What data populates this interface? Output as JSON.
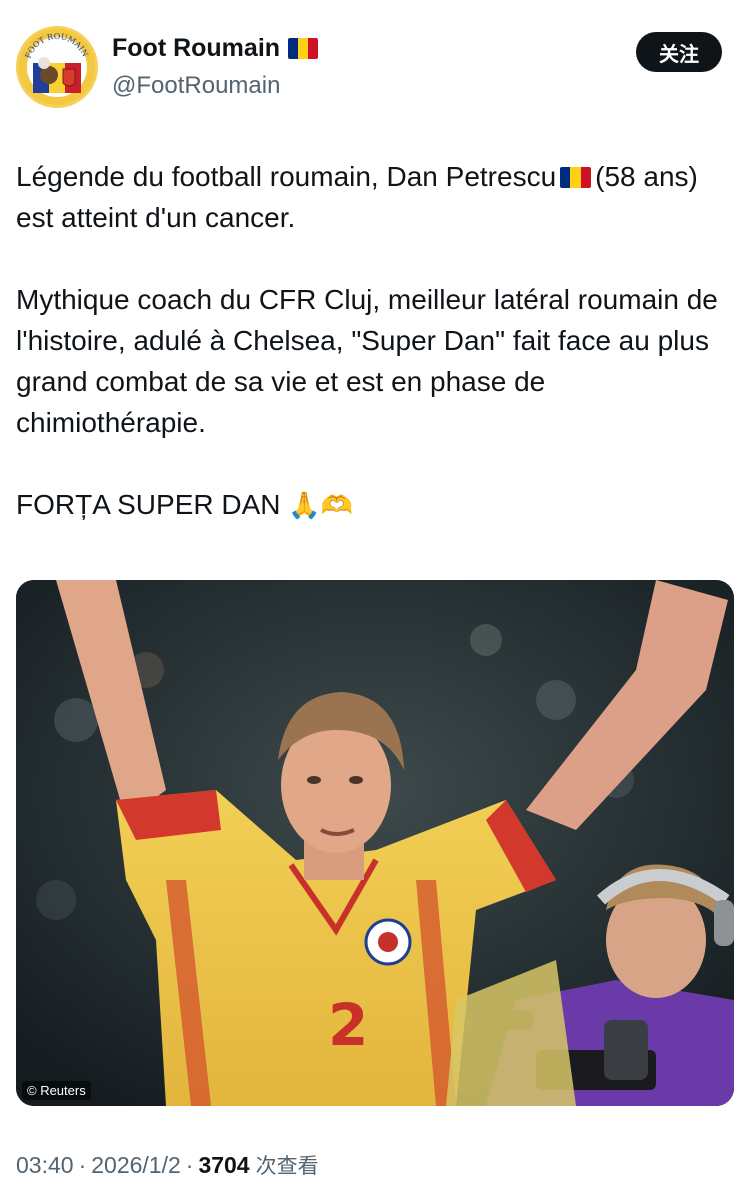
{
  "author": {
    "display_name": "Foot Roumain",
    "handle": "@FootRoumain",
    "avatar_icon": "foot-roumain-logo",
    "avatar_text": "FOOT ROUMAIN",
    "flag_colors": [
      "#002B7F",
      "#FCD116",
      "#CE1126"
    ]
  },
  "follow_button": {
    "label": "关注"
  },
  "tweet": {
    "line1_before_flag": "Légende du football roumain, Dan Petrescu",
    "line1_after_flag": "(58 ans) est atteint d'un cancer.",
    "paragraph2": "Mythique coach du CFR Cluj, meilleur latéral roumain de l'histoire, adulé à Chelsea, \"Super Dan\" fait face au plus grand combat de sa vie et est en phase de chimiothérapie.",
    "paragraph3": "FORȚA SUPER DAN",
    "emojis": "🙏🫶"
  },
  "media": {
    "credit": "© Reuters"
  },
  "meta": {
    "time": "03:40",
    "date": "2026/1/2",
    "views": "3704",
    "views_label": "次查看",
    "separator": "·"
  }
}
